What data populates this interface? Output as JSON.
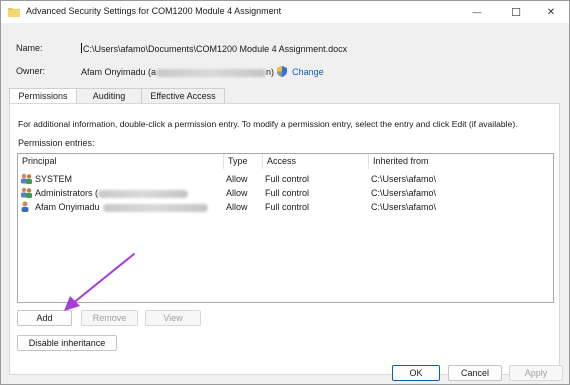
{
  "window": {
    "title": "Advanced Security Settings for COM1200 Module 4 Assignment",
    "minimize_glyph": "—",
    "maximize_glyph": "☐",
    "close_glyph": "✕"
  },
  "header": {
    "name_label": "Name:",
    "name_value": "C:\\Users\\afamo\\Documents\\COM1200 Module 4 Assignment.docx",
    "owner_label": "Owner:",
    "owner_name": "Afam Onyimadu (a",
    "owner_suffix": "n)",
    "change_label": "Change"
  },
  "tabs": [
    {
      "label": "Permissions",
      "active": true
    },
    {
      "label": "Auditing",
      "active": false
    },
    {
      "label": "Effective Access",
      "active": false
    }
  ],
  "permissions": {
    "info_text": "For additional information, double-click a permission entry. To modify a permission entry, select the entry and click Edit (if available).",
    "entries_label": "Permission entries:",
    "columns": [
      "Principal",
      "Type",
      "Access",
      "Inherited from"
    ],
    "rows": [
      {
        "principal": "SYSTEM",
        "type": "Allow",
        "access": "Full control",
        "inherited": "C:\\Users\\afamo\\",
        "icon": "group-icon"
      },
      {
        "principal": "Administrators (",
        "type": "Allow",
        "access": "Full control",
        "inherited": "C:\\Users\\afamo\\",
        "icon": "group-icon"
      },
      {
        "principal": "Afam Onyimadu",
        "type": "Allow",
        "access": "Full control",
        "inherited": "C:\\Users\\afamo\\",
        "icon": "user-icon"
      }
    ],
    "add_label": "Add",
    "remove_label": "Remove",
    "view_label": "View",
    "disable_inheritance_label": "Disable inheritance"
  },
  "footer": {
    "ok_label": "OK",
    "cancel_label": "Cancel",
    "apply_label": "Apply"
  },
  "colors": {
    "accent": "#005fb8",
    "link": "#0b5cad",
    "annotation_arrow": "#a63dd8"
  }
}
